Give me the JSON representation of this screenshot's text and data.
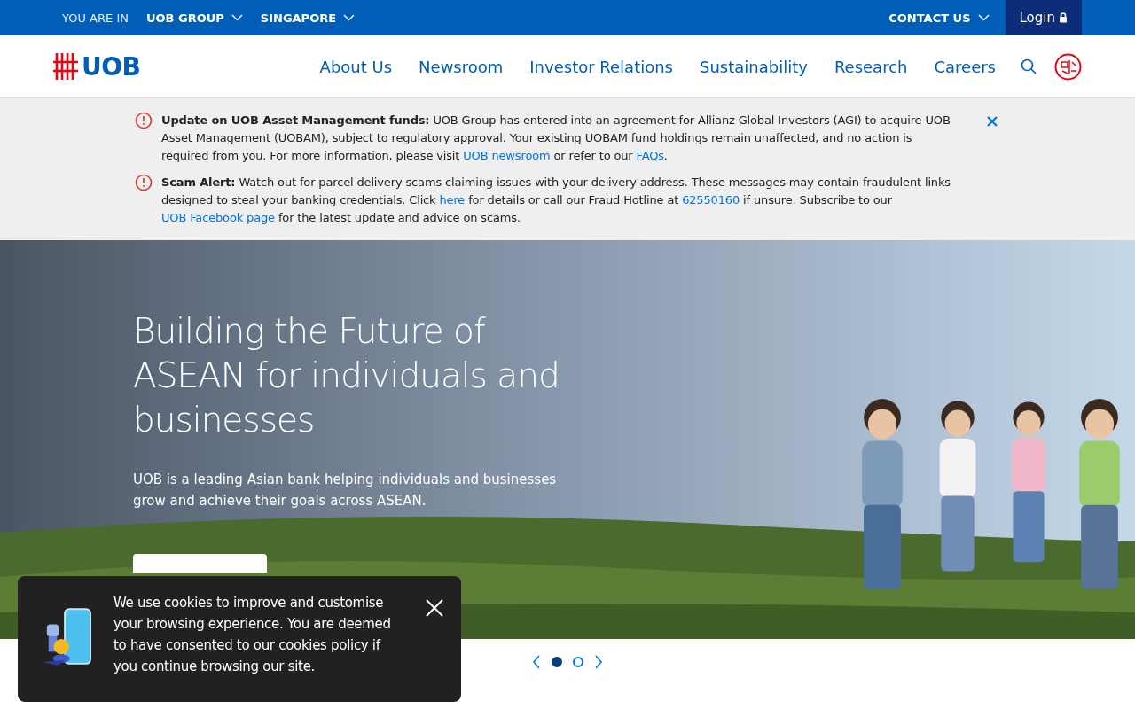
{
  "top_bar": {
    "location_label": "YOU ARE IN",
    "selectors": [
      "UOB GROUP",
      "SINGAPORE"
    ],
    "contact": "CONTACT US",
    "login": "Login"
  },
  "nav": {
    "logo": "UOB",
    "items": [
      "About Us",
      "Newsroom",
      "Investor Relations",
      "Sustainability",
      "Research",
      "Careers"
    ]
  },
  "alerts": [
    {
      "parts": [
        {
          "kind": "text",
          "text": "**Update on UOB Asset Management funds:** UOB Group has entered into an agreement for Allianz Global Investors (AGI) to acquire UOB Asset Management (UOBAM), subject to regulatory approval. Your existing UOBAM fund holdings remain unaffected, and no action is required from you. For more information, please visit "
        },
        {
          "kind": "link",
          "text": "UOB newsroom"
        },
        {
          "kind": "text",
          "text": " or refer to our "
        },
        {
          "kind": "link",
          "text": "FAQs"
        },
        {
          "kind": "text",
          "text": "."
        }
      ]
    },
    {
      "parts": [
        {
          "kind": "text",
          "text": "**Scam Alert:** Watch out for parcel delivery scams claiming issues with your delivery address. These messages may contain fraudulent links designed to steal your banking credentials. Click "
        },
        {
          "kind": "link",
          "text": "here"
        },
        {
          "kind": "text",
          "text": " for details or call our Fraud Hotline at "
        },
        {
          "kind": "link",
          "text": "62550160"
        },
        {
          "kind": "text",
          "text": " if unsure. Subscribe to our "
        },
        {
          "kind": "link",
          "text": "UOB Facebook page"
        },
        {
          "kind": "text",
          "text": " for the latest update and advice on scams."
        }
      ]
    }
  ],
  "hero": {
    "kind": "picture",
    "title": "Building the Future of ASEAN for individuals and businesses",
    "text": "UOB is a leading Asian bank helping individuals and businesses grow and achieve their goals across ASEAN."
  },
  "carousel": {
    "dots": [
      {
        "selected": true
      },
      {
        "selected": false
      }
    ]
  },
  "cookie_banner": {
    "text": "We use cookies to improve and customise your browsing experience. You are deemed to have consented to our cookies policy if you continue browsing our site."
  }
}
